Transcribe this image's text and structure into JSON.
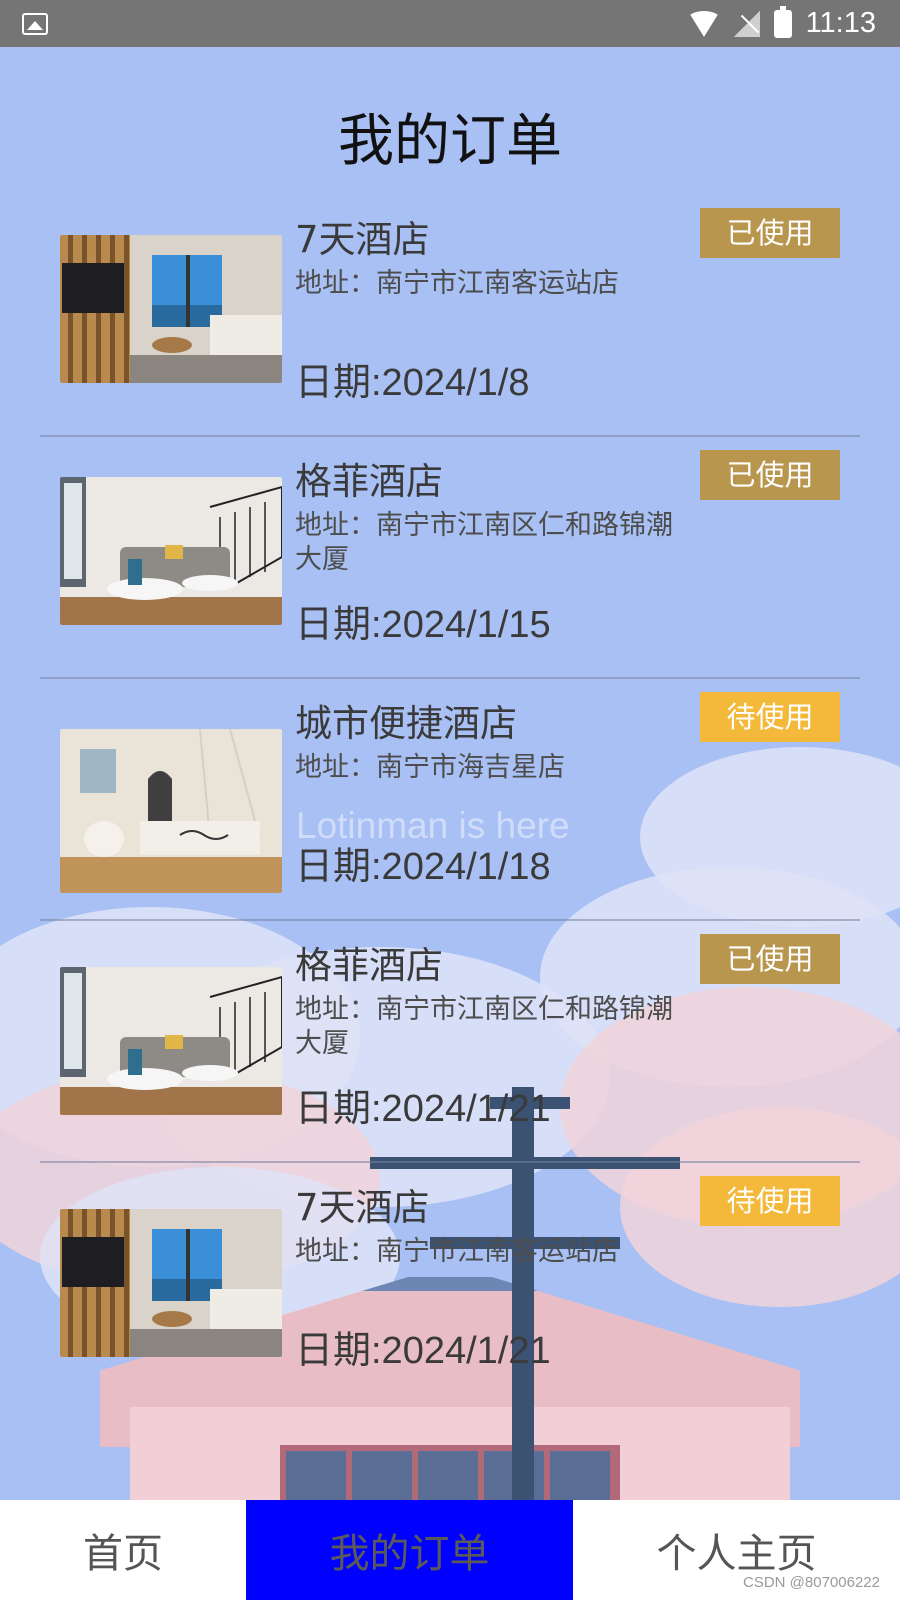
{
  "status_bar": {
    "time": "11:13",
    "icons": [
      "image-icon",
      "wifi-icon",
      "signal-off-icon",
      "battery-charging-icon"
    ]
  },
  "page": {
    "title": "我的订单"
  },
  "orders": [
    {
      "name": "7天酒店",
      "address": "地址：南宁市江南客运站店",
      "date": "日期:2024/1/8",
      "status": "已使用",
      "status_type": "used",
      "photo": "living-room-bamboo"
    },
    {
      "name": "格菲酒店",
      "address": "地址：南宁市江南区仁和路锦潮大厦",
      "date": "日期:2024/1/15",
      "status": "已使用",
      "status_type": "used",
      "photo": "loft-living-room"
    },
    {
      "name": "城市便捷酒店",
      "address": "地址：南宁市海吉星店",
      "date": "日期:2024/1/18",
      "status": "待使用",
      "status_type": "pending",
      "photo": "white-bedroom"
    },
    {
      "name": "格菲酒店",
      "address": "地址：南宁市江南区仁和路锦潮大厦",
      "date": "日期:2024/1/21",
      "status": "已使用",
      "status_type": "used",
      "photo": "loft-living-room"
    },
    {
      "name": "7天酒店",
      "address": "地址：南宁市江南客运站店",
      "date": "日期:2024/1/21",
      "status": "待使用",
      "status_type": "pending",
      "photo": "living-room-bamboo"
    }
  ],
  "overlay_text": "Lotinman is here",
  "colors": {
    "background": "#a9c0f4",
    "used_badge": "#b8964e",
    "pending_badge": "#f4b83a",
    "nav_active": "#0000ff"
  },
  "bottom_nav": {
    "items": [
      "首页",
      "我的订单",
      "个人主页"
    ],
    "active_index": 1
  },
  "footer_watermark": "CSDN @807006222"
}
